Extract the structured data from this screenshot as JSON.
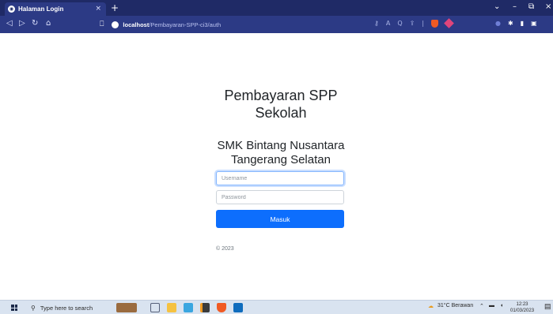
{
  "browser": {
    "tab_title": "Halaman Login",
    "tab_close": "×",
    "new_tab": "+",
    "url_host": "localhost",
    "url_path": "/Pembayaran-SPP-ci3/auth",
    "window_controls": {
      "minimize": "–",
      "maximize": "⧉",
      "close": "×"
    },
    "nav": {
      "back": "◁",
      "forward": "▷",
      "reload": "↻",
      "home": "⌂",
      "bookmark": "⎕"
    },
    "toolbar_icons": [
      "key-icon",
      "translate-icon",
      "zoom-icon",
      "share-icon",
      "brave-shields-icon",
      "brave-rewards-icon",
      "extension-icon",
      "sidebar-icon",
      "wallet-icon"
    ]
  },
  "page": {
    "app_title": "Pembayaran SPP Sekolah",
    "school_name": "SMK Bintang Nusantara Tangerang Selatan",
    "username_placeholder": "Username",
    "password_placeholder": "Password",
    "login_button": "Masuk",
    "footer": "© 2023"
  },
  "taskbar": {
    "search_placeholder": "Type here to search",
    "weather": "31°C  Berawan",
    "time": "12:23",
    "date": "01/03/2023",
    "pinned_apps": [
      "village-icon",
      "task-view-icon",
      "file-explorer-icon",
      "photos-icon",
      "sublime-icon",
      "brave-icon",
      "outlook-icon"
    ]
  },
  "colors": {
    "browser_frame": "#1f2a66",
    "toolbar": "#2c3a85",
    "primary": "#0d6efd",
    "taskbar": "#d9e3f0"
  }
}
